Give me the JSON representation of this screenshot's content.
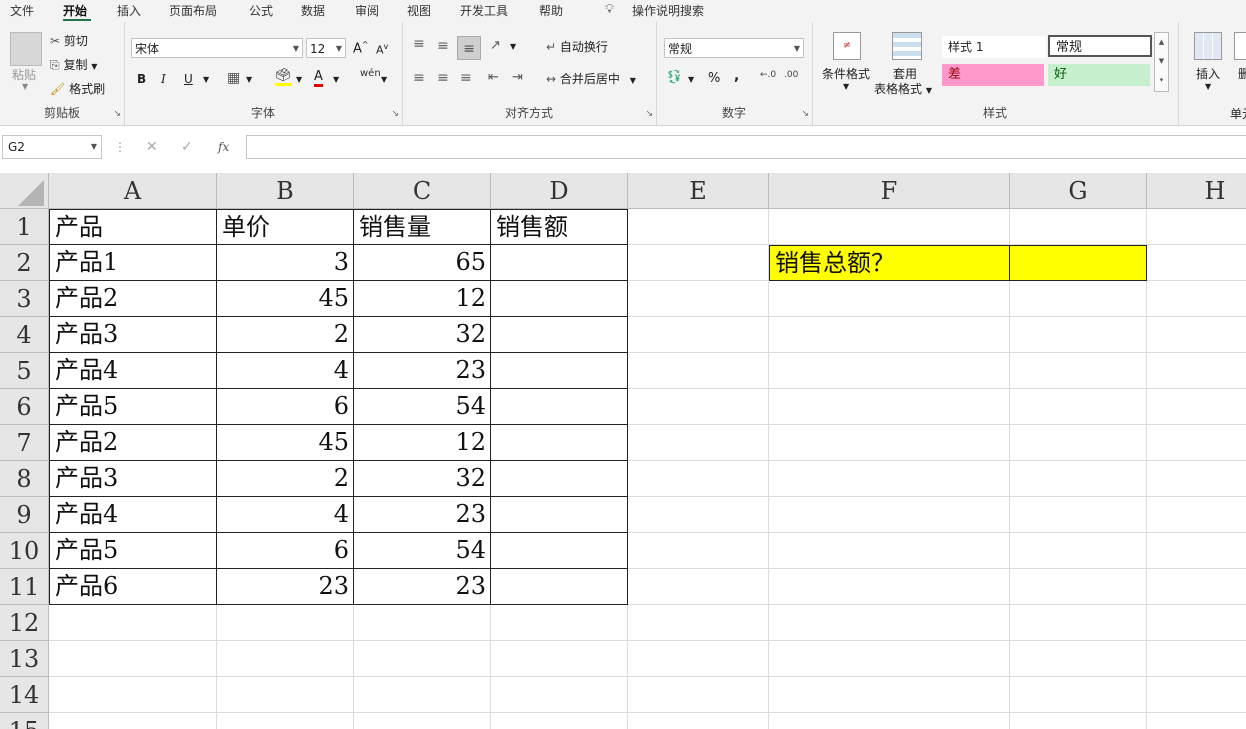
{
  "menu": {
    "tabs": [
      "文件",
      "开始",
      "插入",
      "页面布局",
      "公式",
      "数据",
      "审阅",
      "视图",
      "开发工具",
      "帮助"
    ],
    "active": "开始",
    "tell_me": "操作说明搜索"
  },
  "ribbon": {
    "clipboard": {
      "label": "剪贴板",
      "paste": "粘贴",
      "cut": "剪切",
      "copy": "复制",
      "format_painter": "格式刷"
    },
    "font": {
      "label": "字体",
      "name": "宋体",
      "size": "12",
      "bold": "B",
      "italic": "I",
      "underline": "U",
      "grow": "A",
      "shrink": "A",
      "phonetic": "wén"
    },
    "alignment": {
      "label": "对齐方式",
      "wrap": "自动换行",
      "merge": "合并后居中"
    },
    "number": {
      "label": "数字",
      "format": "常规",
      "percent": "%",
      "comma": ","
    },
    "styles": {
      "label": "样式",
      "cond_format": "条件格式",
      "table_format_1": "套用",
      "table_format_2": "表格格式",
      "style1": "样式 1",
      "normal": "常规",
      "bad": "差",
      "good": "好",
      "color_bad": "#ff99cc",
      "color_good": "#c6efce"
    },
    "cells": {
      "insert": "插入",
      "delete": "删",
      "label_partial": "单元"
    }
  },
  "formula_bar": {
    "name_box": "G2",
    "fx": "fx",
    "formula": ""
  },
  "columns": [
    "A",
    "B",
    "C",
    "D",
    "E",
    "F",
    "G",
    "H"
  ],
  "rows": [
    "1",
    "2",
    "3",
    "4",
    "5",
    "6",
    "7",
    "8",
    "9",
    "10",
    "11",
    "12",
    "13",
    "14",
    "15"
  ],
  "table": {
    "headers": [
      "产品",
      "单价",
      "销售量",
      "销售额"
    ],
    "rows": [
      [
        "产品1",
        "3",
        "65",
        ""
      ],
      [
        "产品2",
        "45",
        "12",
        ""
      ],
      [
        "产品3",
        "2",
        "32",
        ""
      ],
      [
        "产品4",
        "4",
        "23",
        ""
      ],
      [
        "产品5",
        "6",
        "54",
        ""
      ],
      [
        "产品2",
        "45",
        "12",
        ""
      ],
      [
        "产品3",
        "2",
        "32",
        ""
      ],
      [
        "产品4",
        "4",
        "23",
        ""
      ],
      [
        "产品5",
        "6",
        "54",
        ""
      ],
      [
        "产品6",
        "23",
        "23",
        ""
      ]
    ]
  },
  "summary": {
    "label": "销售总额？",
    "value": "",
    "fill": "#ffff00"
  }
}
